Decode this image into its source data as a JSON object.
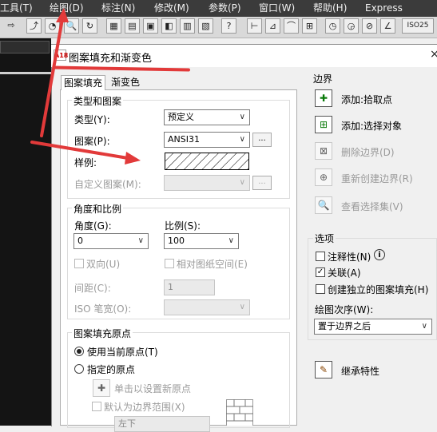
{
  "menubar": {
    "items": [
      "工具(T)",
      "绘图(D)",
      "标注(N)",
      "修改(M)",
      "参数(P)",
      "窗口(W)",
      "帮助(H)",
      "Express"
    ]
  },
  "toolbar": {
    "help_button": "?",
    "right_label": "ISO25"
  },
  "dialog": {
    "icon_text": "A18",
    "title": "图案填充和渐变色",
    "close": "×"
  },
  "tabs": [
    "图案填充",
    "渐变色"
  ],
  "type_pattern": {
    "group_title": "类型和图案",
    "type_label": "类型(Y):",
    "type_value": "预定义",
    "pattern_label": "图案(P):",
    "pattern_value": "ANSI31",
    "pattern_more": "...",
    "swatch_label": "样例:",
    "custom_label": "自定义图案(M):",
    "custom_more": "..."
  },
  "angle_scale": {
    "group_title": "角度和比例",
    "angle_label": "角度(G):",
    "angle_value": "0",
    "scale_label": "比例(S):",
    "scale_value": "100",
    "double_label": "双向(U)",
    "relative_label": "相对图纸空间(E)",
    "spacing_label": "间距(C):",
    "spacing_value": "1",
    "iso_label": "ISO 笔宽(O):"
  },
  "origin": {
    "group_title": "图案填充原点",
    "use_current": "使用当前原点(T)",
    "specified": "指定的原点",
    "click_set": "单击以设置新原点",
    "default_extents": "默认为边界范围(X)",
    "extents_value": "左下"
  },
  "boundaries": {
    "title": "边界",
    "add_pick": "添加:拾取点",
    "add_select": "添加:选择对象",
    "remove": "删除边界(D)",
    "recreate": "重新创建边界(R)",
    "view": "查看选择集(V)"
  },
  "options": {
    "title": "选项",
    "annotative": "注释性(N)",
    "associative": "关联(A)",
    "separate": "创建独立的图案填充(H)",
    "draw_order_label": "绘图次序(W):",
    "draw_order_value": "置于边界之后"
  },
  "inherit": "继承特性",
  "colors": {
    "annotation_red": "#e23a3a",
    "menubar_bg": "#3b3b3b"
  }
}
